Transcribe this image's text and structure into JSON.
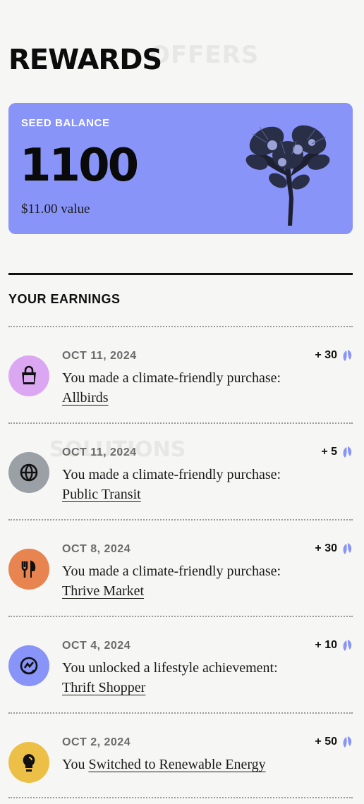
{
  "page": {
    "title": "REWARDS"
  },
  "background_ghost": {
    "tab": "OFFERS",
    "section": "SOLUTIONS"
  },
  "seed_card": {
    "label": "SEED BALANCE",
    "amount": "1100",
    "value": "$11.00 value",
    "color": "#8894f7"
  },
  "earnings": {
    "title": "YOUR EARNINGS",
    "items": [
      {
        "date": "OCT 11, 2024",
        "prefix": "You made a climate-friendly purchase:",
        "link": "Allbirds",
        "points": "+ 30",
        "icon": "shopping-bag-icon",
        "color": "#dca7f2"
      },
      {
        "date": "OCT 11, 2024",
        "prefix": "You made a climate-friendly purchase:",
        "link": "Public Transit",
        "points": "+ 5",
        "icon": "globe-icon",
        "color": "#9aa0a6"
      },
      {
        "date": "OCT 8, 2024",
        "prefix": "You made a climate-friendly purchase:",
        "link": "Thrive Market",
        "points": "+ 30",
        "icon": "utensils-icon",
        "color": "#e8844f"
      },
      {
        "date": "OCT 4, 2024",
        "prefix": "You unlocked a lifestyle achievement:",
        "link": "Thrift Shopper",
        "points": "+ 10",
        "icon": "recycle-icon",
        "color": "#8894f7"
      },
      {
        "date": "OCT 2, 2024",
        "prefix": "You",
        "link": "Switched to Renewable Energy",
        "points": "+ 50",
        "icon": "lightbulb-icon",
        "color": "#ecc046"
      }
    ]
  },
  "seed_icon_color": "#8894f7"
}
